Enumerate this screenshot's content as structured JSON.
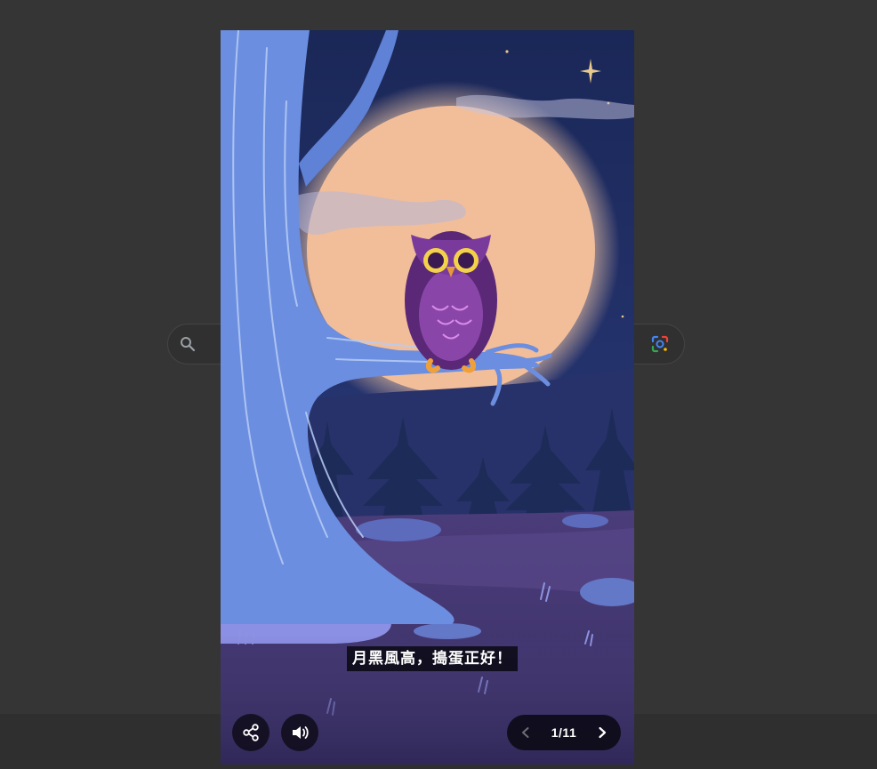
{
  "story": {
    "caption": "月黑風高，搗蛋正好！",
    "page_indicator": "1/11"
  },
  "icons": {
    "search": "search-icon",
    "lens": "google-lens-icon",
    "share": "share-icon",
    "sound": "speaker-icon",
    "prev": "chevron-left-icon",
    "next": "chevron-right-icon"
  },
  "colors": {
    "background": "#353535",
    "sky": "#1b2a5c",
    "moon": "#f2be9a",
    "tree": "#6b8ee0",
    "owl": "#6a2f8a",
    "ground": "#4a3f78",
    "control_bg": "#0f0c19"
  }
}
